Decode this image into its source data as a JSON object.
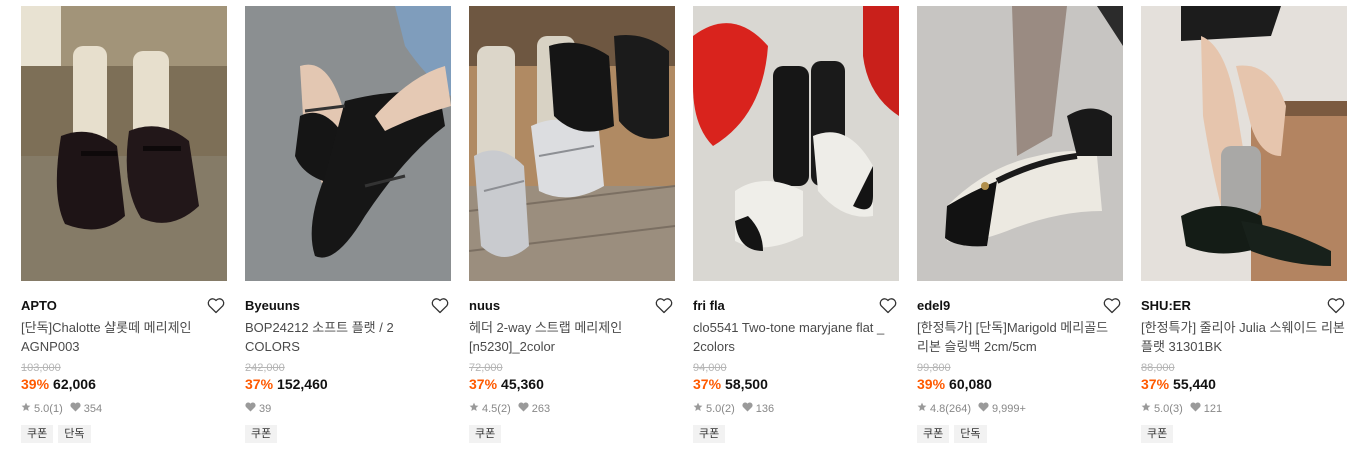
{
  "colors": {
    "discount": "#ff5a00",
    "original_price": "#b5b5b5",
    "meta": "#888888",
    "tag_bg": "#f2f2f2"
  },
  "products": [
    {
      "brand": "APTO",
      "name": "[단독]Chalotte 샬롯떼 메리제인 AGNP003",
      "original_price": "103,000",
      "discount": "39%",
      "price": "62,006",
      "rating": "5.0",
      "review_count": "(1)",
      "likes": "354",
      "tags": [
        "쿠폰",
        "단독"
      ],
      "image": "photo-shoe-black-maryjane-cream-socks"
    },
    {
      "brand": "Byeuuns",
      "name": "BOP24212 소프트 플랫 / 2 COLORS",
      "original_price": "242,000",
      "discount": "37%",
      "price": "152,460",
      "likes": "39",
      "tags": [
        "쿠폰"
      ],
      "image": "photo-shoe-black-pointed-flat"
    },
    {
      "brand": "nuus",
      "name": "헤더 2-way 스트랩 메리제인 [n5230]_2color",
      "original_price": "72,000",
      "discount": "37%",
      "price": "45,360",
      "rating": "4.5",
      "review_count": "(2)",
      "likes": "263",
      "tags": [
        "쿠폰"
      ],
      "image": "photo-shoe-silver-strap-maryjane"
    },
    {
      "brand": "fri fla",
      "name": "clo5541 Two-tone maryjane flat _ 2colors",
      "original_price": "94,000",
      "discount": "37%",
      "price": "58,500",
      "rating": "5.0",
      "review_count": "(2)",
      "likes": "136",
      "tags": [
        "쿠폰"
      ],
      "image": "photo-shoe-two-tone-maryjane"
    },
    {
      "brand": "edel9",
      "name": "[한정특가] [단독]Marigold 메리골드 리본 슬링백 2cm/5cm",
      "original_price": "99,800",
      "discount": "39%",
      "price": "60,080",
      "rating": "4.8",
      "review_count": "(264)",
      "likes": "9,999+",
      "tags": [
        "쿠폰",
        "단독"
      ],
      "image": "photo-shoe-cream-black-slingback"
    },
    {
      "brand": "SHU:ER",
      "name": "[한정특가] 줄리아 Julia 스웨이드 리본 플랫 31301BK",
      "original_price": "88,000",
      "discount": "37%",
      "price": "55,440",
      "rating": "5.0",
      "review_count": "(3)",
      "likes": "121",
      "tags": [
        "쿠폰"
      ],
      "image": "photo-shoe-black-suede-ribbon-flat"
    }
  ]
}
